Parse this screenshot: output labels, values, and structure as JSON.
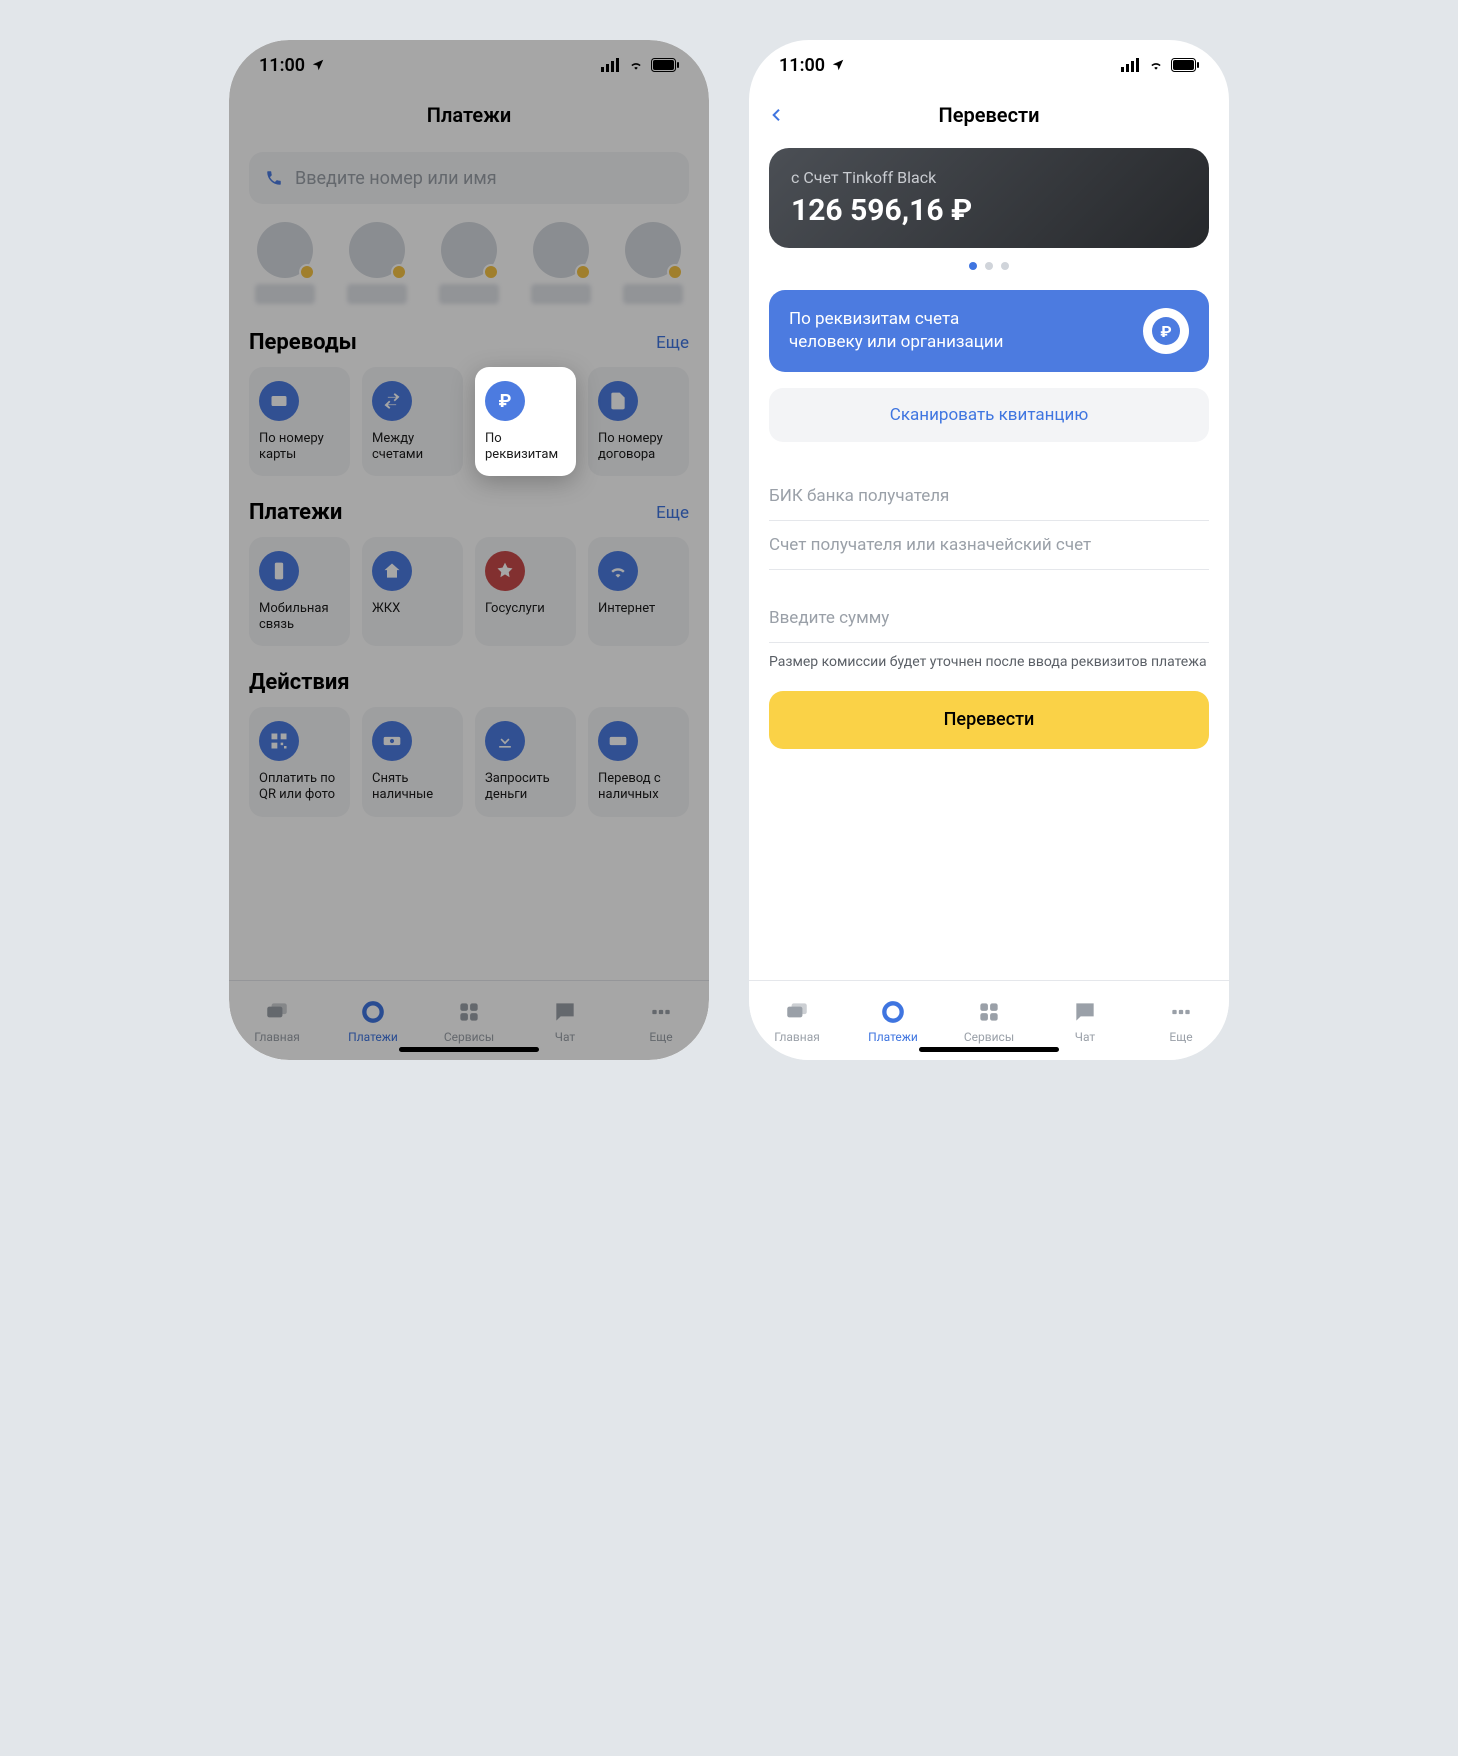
{
  "status": {
    "time": "11:00"
  },
  "left": {
    "header": "Платежи",
    "search_placeholder": "Введите номер или имя",
    "section_transfers": "Переводы",
    "section_payments": "Платежи",
    "section_actions": "Действия",
    "more": "Еще",
    "transfers": {
      "card": "По номеру карты",
      "between": "Между счетами",
      "requisites": "По реквизитам",
      "contract": "По номеру договора"
    },
    "payments": {
      "mobile": "Мобильная связь",
      "zhkh": "ЖКХ",
      "gos": "Госуслуги",
      "internet": "Интернет"
    },
    "actions": {
      "qr": "Оплатить по QR или фото",
      "cash": "Снять наличные",
      "request": "Запросить деньги",
      "cash_transfer": "Перевод с наличных"
    }
  },
  "right": {
    "header": "Перевести",
    "account_from_label": "с Счет Tinkoff Black",
    "account_balance": "126 596,16 ₽",
    "requisites_text_l1": "По реквизитам счета",
    "requisites_text_l2": "человеку или организации",
    "scan": "Сканировать квитанцию",
    "field_bik": "БИК банка получателя",
    "field_account": "Счет получателя или казначейский счет",
    "field_amount": "Введите сумму",
    "fee_note": "Размер комиссии будет уточнен после ввода реквизитов платежа",
    "submit": "Перевести"
  },
  "tabs": {
    "home": "Главная",
    "payments": "Платежи",
    "services": "Сервисы",
    "chat": "Чат",
    "more": "Еще"
  }
}
